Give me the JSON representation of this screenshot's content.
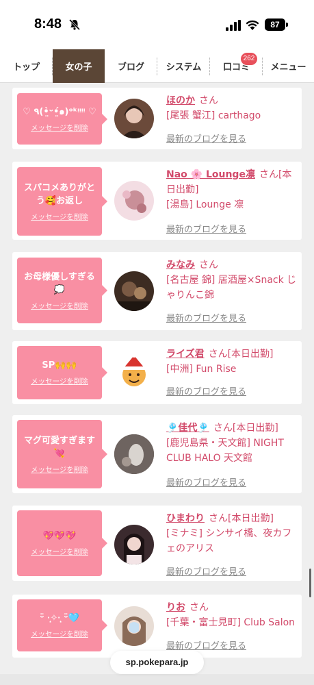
{
  "status": {
    "time": "8:48",
    "battery": "87"
  },
  "tabs": [
    {
      "label": "トップ"
    },
    {
      "label": "女の子"
    },
    {
      "label": "ブログ"
    },
    {
      "label": "システム"
    },
    {
      "label": "口コミ"
    },
    {
      "label": "メニュー"
    }
  ],
  "badge_count": "262",
  "active_tab": "女の子",
  "delete_label": "メッセージを削除",
  "san": "さん",
  "blog_label": "最新のブログを見る",
  "cards": [
    {
      "message": "♡ ٩(•̤̀ᵕ•̤́๑)ᵒᵏᵎᵎᵎᵎ ♡",
      "name": "ほのか",
      "status": "",
      "shop": "[尾張 蟹江] carthago",
      "avatar_color": "#6b4a3a"
    },
    {
      "message": "スパコメありがとう🥰お返し",
      "name": "Nao 🌸 Lounge凛",
      "status": "[本日出勤]",
      "shop": "[湯島] Lounge 凛",
      "avatar_color": "#d9a8b4"
    },
    {
      "message": "お母様優しすぎる💭",
      "name": "みなみ",
      "status": "",
      "shop": "[名古屋 錦] 居酒屋×Snack じゃりんこ錦",
      "avatar_color": "#3d2c22"
    },
    {
      "message": "SP🙌🙌",
      "name": "ライズ君",
      "status": "[本日出勤]",
      "shop": "[中洲] Fun Rise",
      "avatar_color": "#f3b04a"
    },
    {
      "message": "マグ可愛すぎます💘",
      "name": "🎐佳代🎐",
      "status": "[本日出勤]",
      "shop": "[鹿児島県・天文館] NIGHT CLUB HALO 天文館",
      "avatar_color": "#5a4f4a"
    },
    {
      "message": "💖💖💖",
      "name": "ひまわり",
      "status": "[本日出勤]",
      "shop": "[ミナミ] シンサイ橋、夜カフェのアリス",
      "avatar_color": "#3b2a2e"
    },
    {
      "message": "ᵕ̈ ·̩͙✧·̩͙ ᵕ̈🩵",
      "name": "りお",
      "status": "",
      "shop": "[千葉・富士見町] Club Salon",
      "avatar_color": "#c9b6a6"
    }
  ],
  "browser": {
    "url": "sp.pokepara.jp"
  },
  "colors": {
    "accent_pink": "#f98fa3",
    "link_pink": "#d24a6a",
    "active_tab": "#5b4636",
    "badge": "#e8505b"
  }
}
